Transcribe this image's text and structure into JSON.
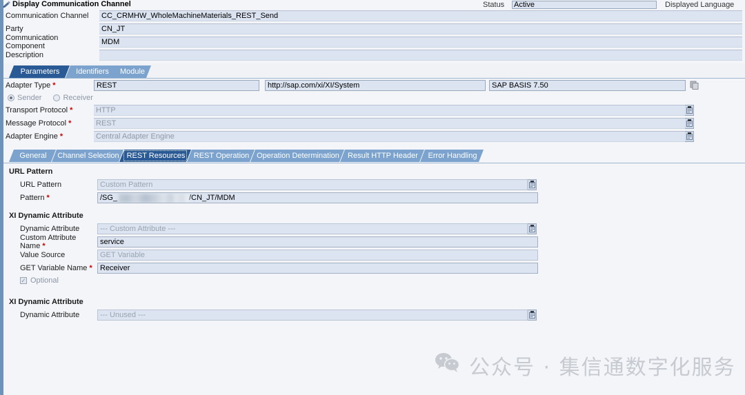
{
  "window": {
    "title": "Display Communication Channel",
    "title_icon": "pencil-channel-icon"
  },
  "status_bar": {
    "status_label": "Status",
    "status_value": "Active",
    "displayed_language_label": "Displayed Language"
  },
  "header_form": {
    "rows": [
      {
        "label": "Communication Channel",
        "value": "CC_CRMHW_WholeMachineMaterials_REST_Send"
      },
      {
        "label": "Party",
        "value": "CN_JT"
      },
      {
        "label": "Communication Component",
        "value": "MDM"
      },
      {
        "label": "Description",
        "value": ""
      }
    ]
  },
  "outer_tabs": [
    {
      "label": "Parameters",
      "active": true
    },
    {
      "label": "Identifiers",
      "active": false
    },
    {
      "label": "Module",
      "active": false
    }
  ],
  "parameters": {
    "adapter_type": {
      "label": "Adapter Type",
      "required": "*",
      "value": "REST",
      "namespace": "http://sap.com/xi/XI/System",
      "software_component": "SAP BASIS 7.50",
      "copy_icon": "copy-icon"
    },
    "direction": {
      "sender_label": "Sender",
      "receiver_label": "Receiver",
      "selected": "Sender"
    },
    "transport_protocol": {
      "label": "Transport Protocol",
      "required": "*",
      "value": "HTTP"
    },
    "message_protocol": {
      "label": "Message Protocol",
      "required": "*",
      "value": "REST"
    },
    "adapter_engine": {
      "label": "Adapter Engine",
      "required": "*",
      "value": "Central Adapter Engine"
    }
  },
  "inner_tabs": [
    {
      "label": "General",
      "active": false
    },
    {
      "label": "Channel Selection",
      "active": false
    },
    {
      "label": "REST Resources",
      "active": true
    },
    {
      "label": "REST Operation",
      "active": false
    },
    {
      "label": "Operation Determination",
      "active": false
    },
    {
      "label": "Result HTTP Header",
      "active": false
    },
    {
      "label": "Error Handling",
      "active": false
    }
  ],
  "rest_resources": {
    "url_pattern_section": {
      "title": "URL Pattern",
      "url_pattern": {
        "label": "URL Pattern",
        "required": "",
        "value": "Custom Pattern"
      },
      "pattern": {
        "label": "Pattern",
        "required": "*",
        "prefix": "/SG_",
        "suffix": "/CN_JT/MDM",
        "redacted": true
      }
    },
    "xi_dynamic_attribute_1": {
      "title": "XI Dynamic Attribute",
      "dynamic_attribute": {
        "label": "Dynamic Attribute",
        "required": "",
        "value": "--- Custom Attribute ---"
      },
      "custom_attribute_name": {
        "label": "Custom Attribute Name",
        "required": "*",
        "value": "service"
      },
      "value_source": {
        "label": "Value Source",
        "required": "",
        "value": "GET Variable"
      },
      "get_variable_name": {
        "label": "GET Variable Name",
        "required": "*",
        "value": "Receiver"
      },
      "optional": {
        "label": "Optional",
        "checked": true,
        "mark": "✓"
      }
    },
    "xi_dynamic_attribute_2": {
      "title": "XI Dynamic Attribute",
      "dynamic_attribute": {
        "label": "Dynamic Attribute",
        "required": "",
        "value": "--- Unused ---"
      }
    }
  },
  "watermark": {
    "icon": "wechat-icon",
    "text": "公众号 · 集信通数字化服务"
  },
  "colors": {
    "accent_blue": "#2a5a95",
    "tab_blue": "#7ba3cd",
    "field_blue": "#dbe4f0",
    "page_bg": "#f3f5f8",
    "required_red": "#cc0000",
    "strip_blue": "#6d93ba"
  }
}
